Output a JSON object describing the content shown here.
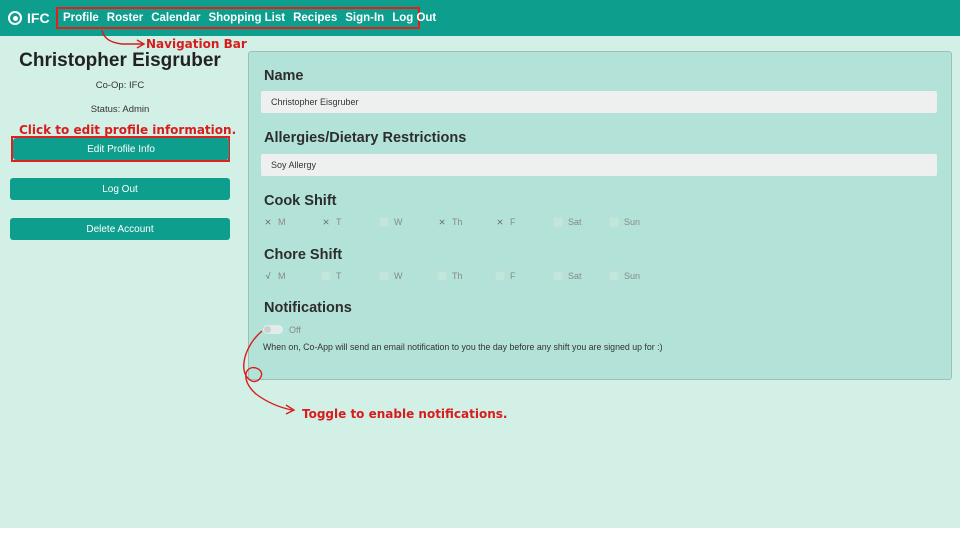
{
  "nav": {
    "brand": "IFC",
    "links": [
      "Profile",
      "Roster",
      "Calendar",
      "Shopping List",
      "Recipes",
      "Sign-In",
      "Log Out"
    ]
  },
  "annotations": {
    "nav_bar": "Navigation Bar",
    "edit_profile": "Click to edit profile information.",
    "toggle": "Toggle to enable notifications.",
    "color": "#d81c1c"
  },
  "sidebar": {
    "name": "Christopher Eisgruber",
    "coop": "Co-Op: IFC",
    "status": "Status: Admin",
    "edit_button": "Edit Profile Info",
    "logout_button": "Log Out",
    "delete_button": "Delete Account"
  },
  "profile": {
    "name_label": "Name",
    "name_value": "Christopher Eisgruber",
    "allergies_label": "Allergies/Dietary Restrictions",
    "allergies_value": "Soy Allergy",
    "cook_label": "Cook Shift",
    "cook_days": [
      {
        "day": "M",
        "checked": true
      },
      {
        "day": "T",
        "checked": true
      },
      {
        "day": "W",
        "checked": false
      },
      {
        "day": "Th",
        "checked": true
      },
      {
        "day": "F",
        "checked": true
      },
      {
        "day": "Sat",
        "checked": false
      },
      {
        "day": "Sun",
        "checked": false
      }
    ],
    "chore_label": "Chore Shift",
    "chore_days": [
      {
        "day": "M",
        "checked": true
      },
      {
        "day": "T",
        "checked": false
      },
      {
        "day": "W",
        "checked": false
      },
      {
        "day": "Th",
        "checked": false
      },
      {
        "day": "F",
        "checked": false
      },
      {
        "day": "Sat",
        "checked": false
      },
      {
        "day": "Sun",
        "checked": false
      }
    ],
    "notifications_label": "Notifications",
    "toggle_state": "Off",
    "notifications_desc": "When on, Co-App will send an email notification to you the day before any shift you are signed up for :)"
  },
  "colors": {
    "accent": "#0e9e8e",
    "background": "#d3f0e7",
    "panel": "#b3e3d8"
  }
}
